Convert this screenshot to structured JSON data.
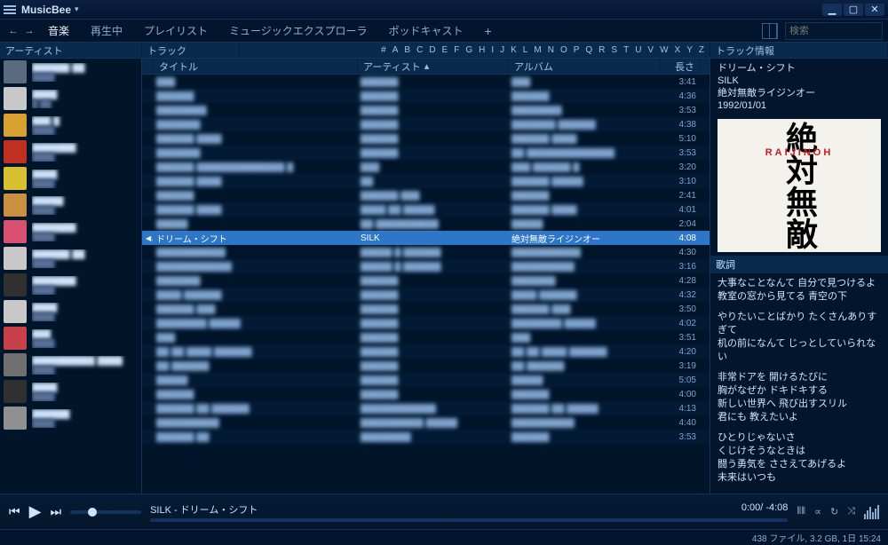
{
  "app": {
    "name": "MusicBee"
  },
  "nav": {
    "tabs": [
      "音楽",
      "再生中",
      "プレイリスト",
      "ミュージックエクスプローラ",
      "ポッドキャスト"
    ],
    "active": 0
  },
  "search": {
    "placeholder": "検索"
  },
  "headers": {
    "artists": "アーティスト",
    "tracks": "トラック",
    "track_info": "トラック情報",
    "title": "タイトル",
    "artist": "アーティスト",
    "album": "アルバム",
    "length": "長さ"
  },
  "alpha": [
    "#",
    "A",
    "B",
    "C",
    "D",
    "E",
    "F",
    "G",
    "H",
    "I",
    "J",
    "K",
    "L",
    "M",
    "N",
    "O",
    "P",
    "Q",
    "R",
    "S",
    "T",
    "U",
    "V",
    "W",
    "X",
    "Y",
    "Z"
  ],
  "artists": [
    {
      "name": "██████ ██",
      "sub": "████"
    },
    {
      "name": "████",
      "sub": "█ ██"
    },
    {
      "name": "███ █",
      "sub": "████"
    },
    {
      "name": "███████",
      "sub": "████"
    },
    {
      "name": "████",
      "sub": "████"
    },
    {
      "name": "█████",
      "sub": "████"
    },
    {
      "name": "███████",
      "sub": "████"
    },
    {
      "name": "██████ ██",
      "sub": "████"
    },
    {
      "name": "███████",
      "sub": "████"
    },
    {
      "name": "████",
      "sub": "████"
    },
    {
      "name": "███",
      "sub": "████"
    },
    {
      "name": "██████████ ████",
      "sub": "████"
    },
    {
      "name": "████",
      "sub": "████"
    },
    {
      "name": "██████",
      "sub": "████"
    }
  ],
  "tracks": [
    {
      "title": "███",
      "artist": "██████",
      "album": "███",
      "length": "3:41"
    },
    {
      "title": "██████",
      "artist": "██████",
      "album": "██████",
      "length": "4:36"
    },
    {
      "title": "████████",
      "artist": "██████",
      "album": "████████",
      "length": "3:53"
    },
    {
      "title": "███████",
      "artist": "██████",
      "album": "███████ ██████",
      "length": "4:38"
    },
    {
      "title": "██████ ████",
      "artist": "██████",
      "album": "██████ ████",
      "length": "5:10"
    },
    {
      "title": "███████",
      "artist": "██████",
      "album": "██ ██████████████",
      "length": "3:53"
    },
    {
      "title": "██████ ██████████████ █",
      "artist": "███",
      "album": "███ ██████ █",
      "length": "3:20"
    },
    {
      "title": "██████ ████",
      "artist": "██",
      "album": "██████ █████",
      "length": "3:10"
    },
    {
      "title": "██████",
      "artist": "██████ ███",
      "album": "██████",
      "length": "2:41"
    },
    {
      "title": "██████ ████",
      "artist": "████ ██ █████",
      "album": "██████ ████",
      "length": "4:01"
    },
    {
      "title": "█████",
      "artist": "██ ██████████",
      "album": "█████",
      "length": "2:04"
    },
    {
      "title": "ドリーム・シフト",
      "artist": "SILK",
      "album": "絶対無敵ライジンオー",
      "length": "4:08",
      "playing": true
    },
    {
      "title": "███████████",
      "artist": "█████ █ ██████",
      "album": "███████████",
      "length": "4:30"
    },
    {
      "title": "████████████",
      "artist": "█████ █ ██████",
      "album": "██████████",
      "length": "3:16"
    },
    {
      "title": "███████",
      "artist": "██████",
      "album": "███████",
      "length": "4:28"
    },
    {
      "title": "████ ██████",
      "artist": "██████",
      "album": "████ ██████",
      "length": "4:32"
    },
    {
      "title": "██████ ███",
      "artist": "██████",
      "album": "██████ ███",
      "length": "3:50"
    },
    {
      "title": "████████ █████",
      "artist": "██████",
      "album": "████████ █████",
      "length": "4:02"
    },
    {
      "title": "███",
      "artist": "██████",
      "album": "███",
      "length": "3:51"
    },
    {
      "title": "██ ██ ████ ██████",
      "artist": "██████",
      "album": "██ ██ ████ ██████",
      "length": "4:20"
    },
    {
      "title": "██ ██████",
      "artist": "██████",
      "album": "██ ██████",
      "length": "3:19"
    },
    {
      "title": "█████",
      "artist": "██████",
      "album": "█████",
      "length": "5:05"
    },
    {
      "title": "██████",
      "artist": "██████",
      "album": "██████",
      "length": "4:00"
    },
    {
      "title": "██████ ██ ██████",
      "artist": "████████████",
      "album": "██████ ██ █████",
      "length": "4:13"
    },
    {
      "title": "██████████",
      "artist": "██████████ █████",
      "album": "██████████",
      "length": "4:40"
    },
    {
      "title": "██████ ██",
      "artist": "████████",
      "album": "██████",
      "length": "3:53"
    }
  ],
  "now_playing": {
    "title": "ドリーム・シフト",
    "artist": "SILK",
    "album": "絶対無敵ライジンオー",
    "date": "1992/01/01",
    "albumart_kanji": "絶対無敵",
    "albumart_brand": "RAIJINOH"
  },
  "lyrics": {
    "header": "歌詞",
    "lines": [
      "大事なことなんて 自分で見つけるよ\n教室の窓から見てる 青空の下",
      "やりたいことばかり たくさんありすぎて\n机の前になんて じっとしていられない",
      "非常ドアを 開けるたびに\n胸がなぜか ドキドキする\n新しい世界へ 飛び出すスリル\n君にも 教えたいよ",
      "ひとりじゃないさ\nくじけそうなときは\n闘う勇気を ささえてあげるよ\n未来はいつも"
    ]
  },
  "player": {
    "now": "SILK - ドリーム・シフト",
    "time": "0:00/ -4:08"
  },
  "status": "438 ファイル, 3.2 GB, 1日 15:24"
}
